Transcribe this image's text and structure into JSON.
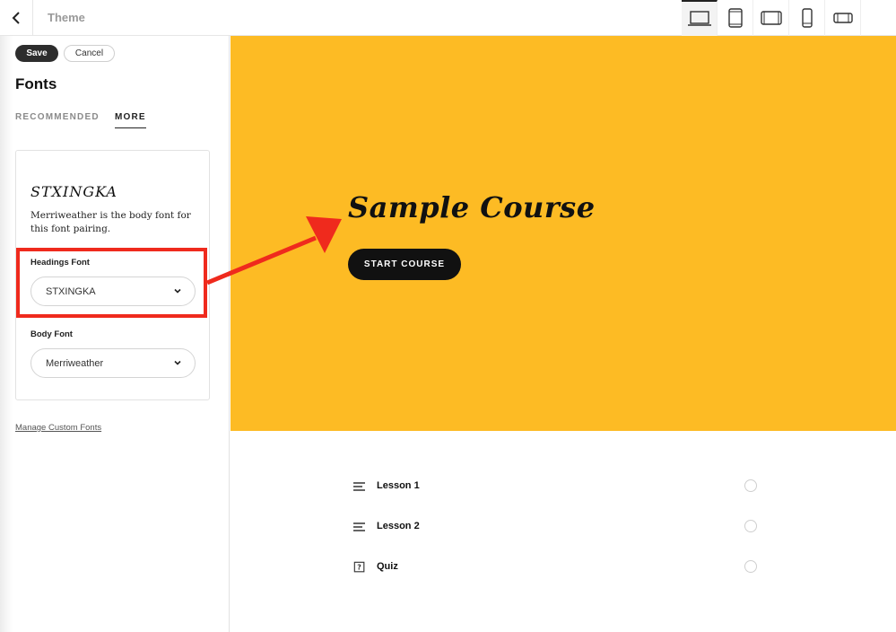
{
  "topbar": {
    "title": "Theme",
    "back_icon": "chevron-left-icon",
    "devices": [
      "laptop-icon",
      "tablet-portrait-icon",
      "tablet-landscape-icon",
      "phone-portrait-icon",
      "phone-landscape-icon"
    ]
  },
  "sidebar": {
    "save_label": "Save",
    "cancel_label": "Cancel",
    "title": "Fonts",
    "tabs": [
      {
        "label": "RECOMMENDED",
        "active": false
      },
      {
        "label": "MORE",
        "active": true
      }
    ],
    "card": {
      "preview_heading": "STXINGKA",
      "description": "Merriweather is the body font for this font pairing.",
      "headings_font_label": "Headings Font",
      "headings_font_value": "STXINGKA",
      "body_font_label": "Body Font",
      "body_font_value": "Merriweather"
    },
    "manage_link": "Manage Custom Fonts"
  },
  "preview": {
    "hero_color": "#fdbb24",
    "course_title": "Sample Course",
    "start_button": "START COURSE",
    "lessons": [
      {
        "icon": "text-lines-icon",
        "label": "Lesson 1"
      },
      {
        "icon": "text-lines-icon",
        "label": "Lesson 2"
      },
      {
        "icon": "quiz-question-icon",
        "label": "Quiz"
      }
    ]
  },
  "annotation": {
    "color": "#ef2a1d"
  }
}
